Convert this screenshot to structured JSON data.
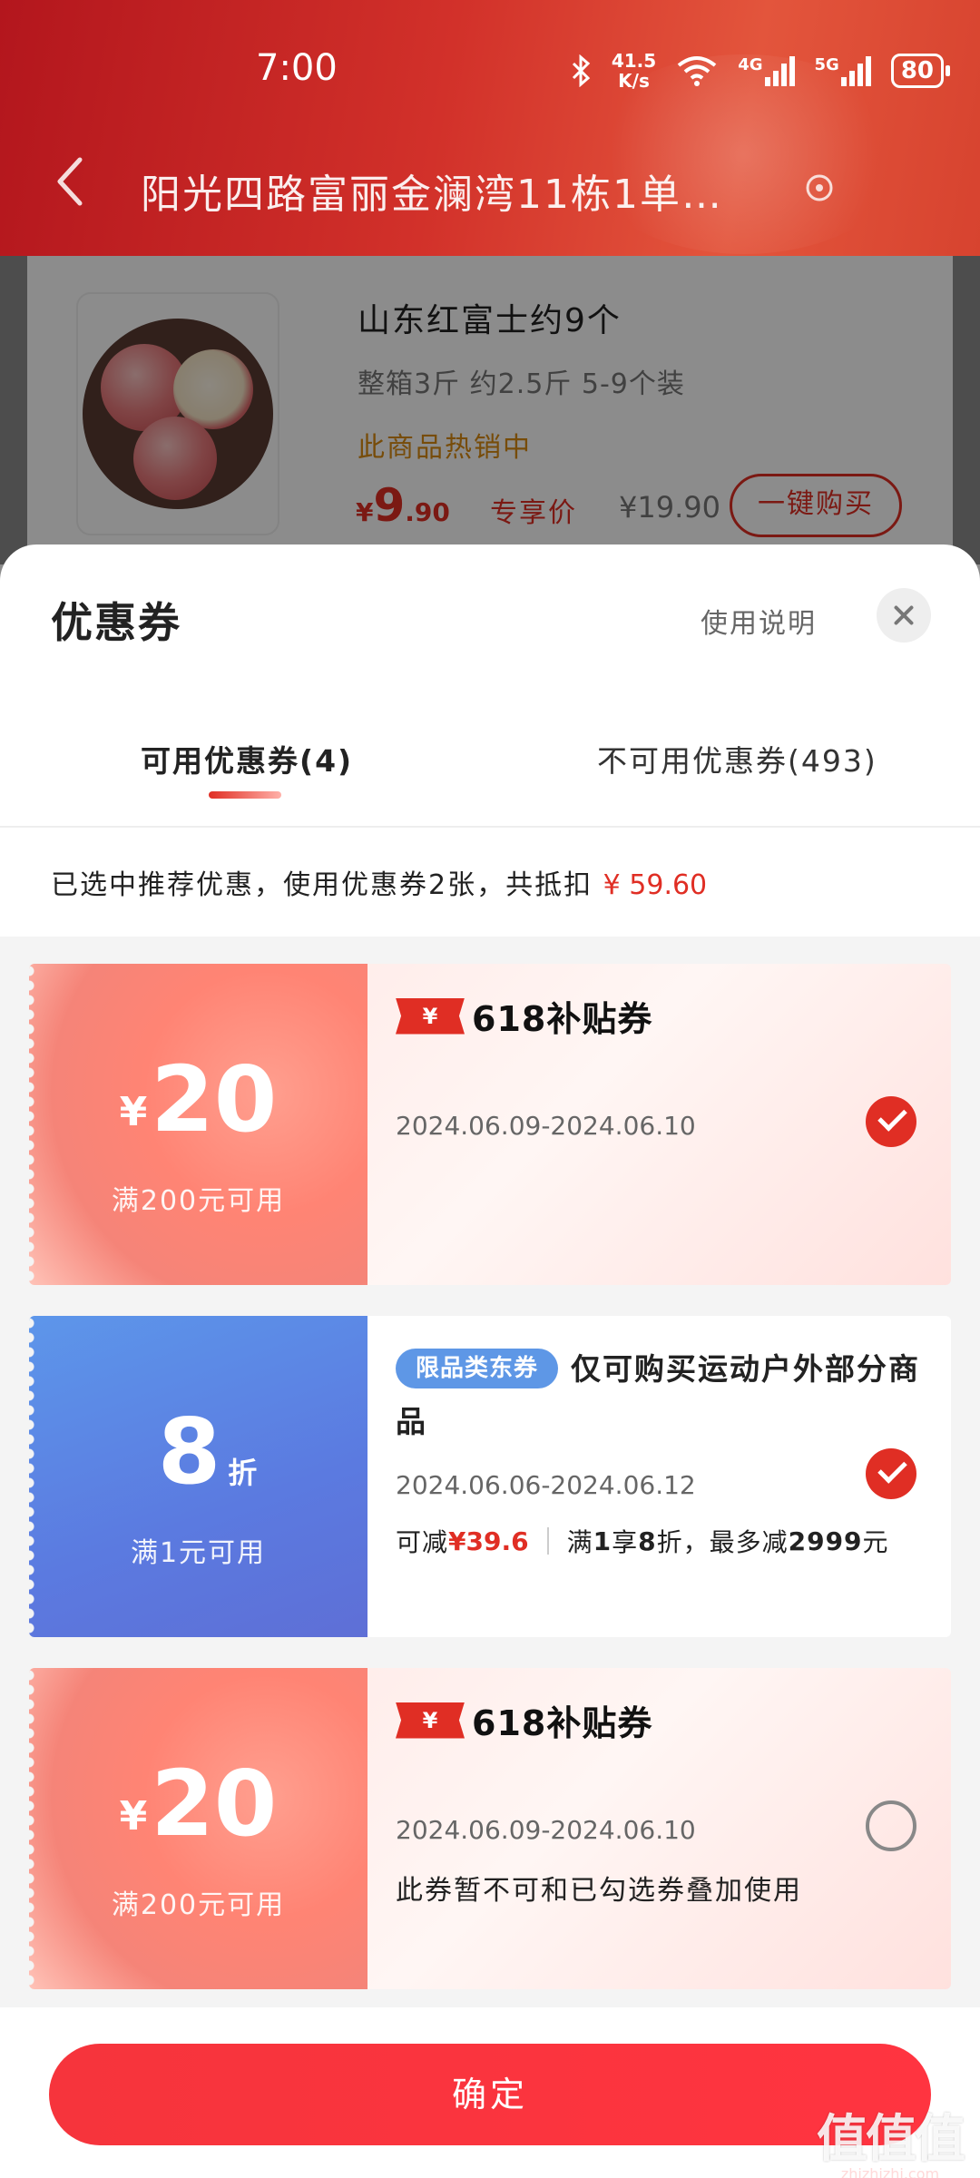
{
  "status_bar": {
    "time": "7:00",
    "net_speed_value": "41.5",
    "net_speed_unit": "K/s",
    "sig1_label": "4G",
    "sig2_label": "5G",
    "battery": "80"
  },
  "header": {
    "address": "阳光四路富丽金澜湾11栋1单…"
  },
  "product": {
    "name": "山东红富士约9个",
    "spec": "整箱3斤  约2.5斤  5-9个装",
    "hot": "此商品热销中",
    "price_symbol": "¥",
    "price_int": "9",
    "price_dec": ".90",
    "price_tag": "专享价",
    "orig_price": "¥19.90",
    "buy_label": "一键购买"
  },
  "sheet": {
    "title": "优惠券",
    "usage_link": "使用说明",
    "tabs": [
      {
        "label": "可用优惠券(4)"
      },
      {
        "label": "不可用优惠券(493)"
      }
    ],
    "summary_prefix": "已选中推荐优惠，使用优惠券2张，共抵扣",
    "summary_amount": "¥ 59.60"
  },
  "coupons": [
    {
      "currency": "¥",
      "amount": "20",
      "condition": "满200元可用",
      "badge_symbol": "¥",
      "badge_text": "618补贴券",
      "date": "2024.06.09-2024.06.10",
      "selected": true
    },
    {
      "amount": "8",
      "unit": "折",
      "condition": "满1元可用",
      "category_pill": "限品类东券",
      "title": "仅可购买运动户外部分商品",
      "date": "2024.06.06-2024.06.12",
      "save_prefix": "可减",
      "save_amount": "¥39.6",
      "rule_prefix": "满",
      "rule_min": "1",
      "rule_mid": "享",
      "rule_discount": "8",
      "rule_mid2": "折，最多减",
      "rule_max": "2999",
      "rule_suffix": "元",
      "selected": true
    },
    {
      "currency": "¥",
      "amount": "20",
      "condition": "满200元可用",
      "badge_symbol": "¥",
      "badge_text": "618补贴券",
      "date": "2024.06.09-2024.06.10",
      "note": "此券暂不可和已勾选券叠加使用",
      "selected": false
    }
  ],
  "confirm_label": "确定",
  "watermark": {
    "main": "值值值",
    "sub": "zhizhizhi.com"
  },
  "colors": {
    "brand_red": "#e02e24",
    "header_red": "#c8251f",
    "coupon_blue": "#5b7ae0",
    "coupon_pink": "#ff8474"
  }
}
